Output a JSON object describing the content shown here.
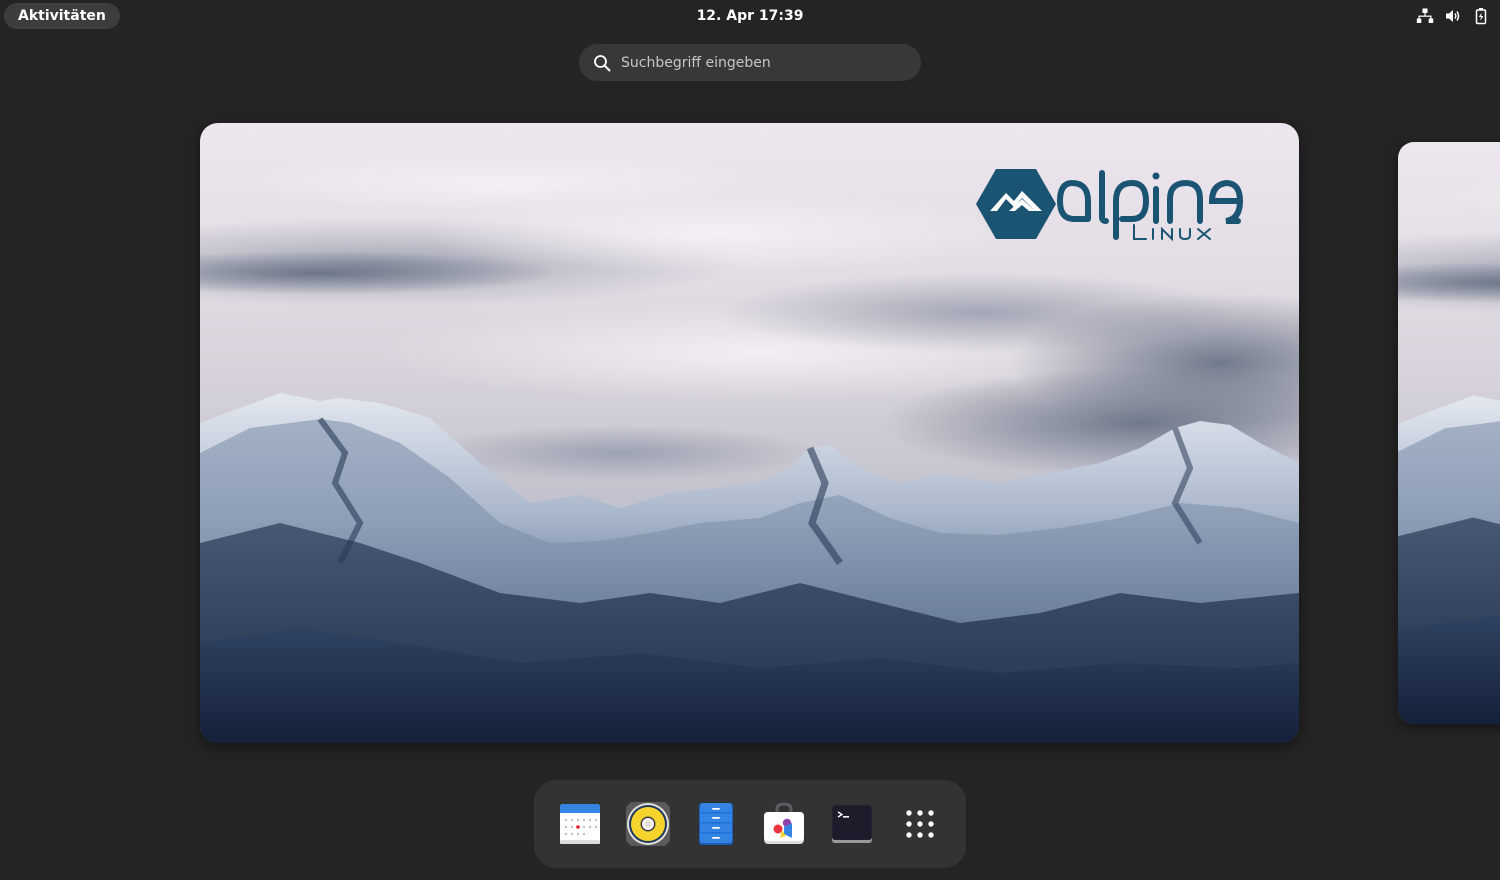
{
  "topbar": {
    "activities_label": "Aktivitäten",
    "clock": "12. Apr  17:39",
    "status_icons": [
      "network-icon",
      "volume-icon",
      "battery-icon"
    ]
  },
  "search": {
    "placeholder": "Suchbegriff eingeben",
    "value": ""
  },
  "workspaces": {
    "active_index": 0,
    "count_visible": 2
  },
  "wallpaper": {
    "logo_text": "alpine",
    "logo_subtext": "Linux",
    "logo_color": "#1b5373"
  },
  "dash": {
    "items": [
      {
        "icon": "calendar-icon"
      },
      {
        "icon": "rhythmbox-icon"
      },
      {
        "icon": "files-icon"
      },
      {
        "icon": "software-icon"
      },
      {
        "icon": "terminal-icon"
      },
      {
        "icon": "app-grid-icon"
      }
    ]
  },
  "colors": {
    "background": "#242424",
    "panel_pill": "#3d3d3d",
    "search_bg": "#383838",
    "dash_bg": "#333333"
  }
}
